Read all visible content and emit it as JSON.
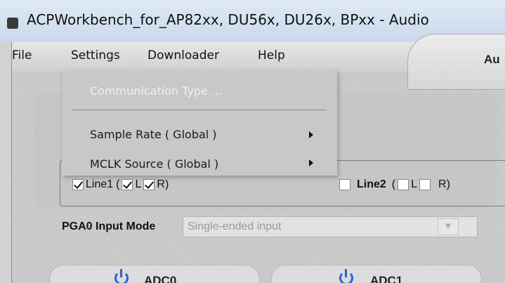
{
  "window": {
    "title": "ACPWorkbench_for_AP82xx, DU56x, DU26x, BPxx - Audio"
  },
  "menubar": {
    "items": [
      "File",
      "Settings",
      "Downloader",
      "Help"
    ]
  },
  "settings_menu": {
    "items": [
      {
        "label": "Communication Type ...",
        "enabled": false,
        "submenu": false
      },
      {
        "label": "Sample Rate ( Global )",
        "enabled": true,
        "submenu": true
      },
      {
        "label": "MCLK Source  ( Global )",
        "enabled": true,
        "submenu": true
      }
    ]
  },
  "top_panel": {
    "label": "Au"
  },
  "inputs": {
    "line1": {
      "label": "Line1",
      "open": "(",
      "l": "L",
      "r": "R",
      "close": ")",
      "checked": true,
      "l_checked": true,
      "r_checked": true
    },
    "line2": {
      "label": "Line2",
      "open": "(",
      "l": "L",
      "r": "R",
      "close": ")",
      "checked": false,
      "l_checked": false,
      "r_checked": false
    }
  },
  "pga0": {
    "label": "PGA0 Input Mode",
    "value": "Single-ended input"
  },
  "adc_tabs": [
    "ADC0",
    "ADC1"
  ],
  "colors": {
    "power_icon": "#2a63d6",
    "disabled_menu_text": "#f0f0f0"
  }
}
